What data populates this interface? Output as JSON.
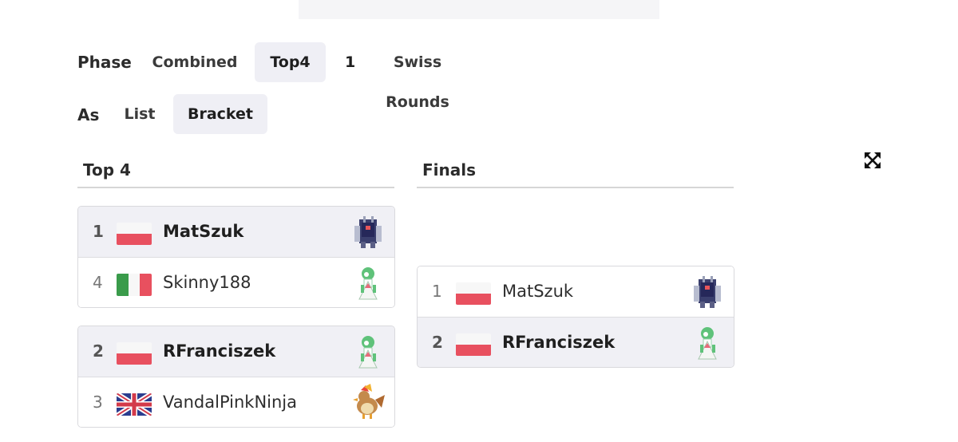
{
  "filters": {
    "phase": {
      "label": "Phase",
      "options": [
        {
          "label": "Combined",
          "active": false
        },
        {
          "label": "Top4",
          "active": true
        }
      ],
      "swiss_count": "1",
      "swiss_label": "Swiss Rounds"
    },
    "view": {
      "label": "As",
      "options": [
        {
          "label": "List",
          "active": false
        },
        {
          "label": "Bracket",
          "active": true
        }
      ]
    }
  },
  "bracket": {
    "columns": [
      {
        "title": "Top 4",
        "matches": [
          {
            "players": [
              {
                "seed": "1",
                "flag": "poland-flag",
                "name": "MatSzuk",
                "winner": true,
                "sprite": "cyan-iron-sprite-icon"
              },
              {
                "seed": "4",
                "flag": "italy-flag",
                "name": "Skinny188",
                "winner": false,
                "sprite": "gardevoir-sprite-icon"
              }
            ]
          },
          {
            "players": [
              {
                "seed": "2",
                "flag": "poland-flag",
                "name": "RFranciszek",
                "winner": true,
                "sprite": "gardevoir-sprite-icon"
              },
              {
                "seed": "3",
                "flag": "uk-flag",
                "name": "VandalPinkNinja",
                "winner": false,
                "sprite": "pidgeotto-sprite-icon"
              }
            ]
          }
        ]
      },
      {
        "title": "Finals",
        "matches": [
          {
            "players": [
              {
                "seed": "1",
                "flag": "poland-flag",
                "name": "MatSzuk",
                "winner": false,
                "sprite": "cyan-iron-sprite-icon"
              },
              {
                "seed": "2",
                "flag": "poland-flag",
                "name": "RFranciszek",
                "winner": true,
                "sprite": "gardevoir-sprite-icon"
              }
            ]
          }
        ]
      }
    ]
  },
  "icons": {
    "expand": "expand-arrows-icon"
  },
  "colors": {
    "active_pill_bg": "#efeff5",
    "winner_row_bg": "#f0f0f5",
    "flag_red": "#e8505f",
    "italy_green": "#3a9b4b"
  }
}
